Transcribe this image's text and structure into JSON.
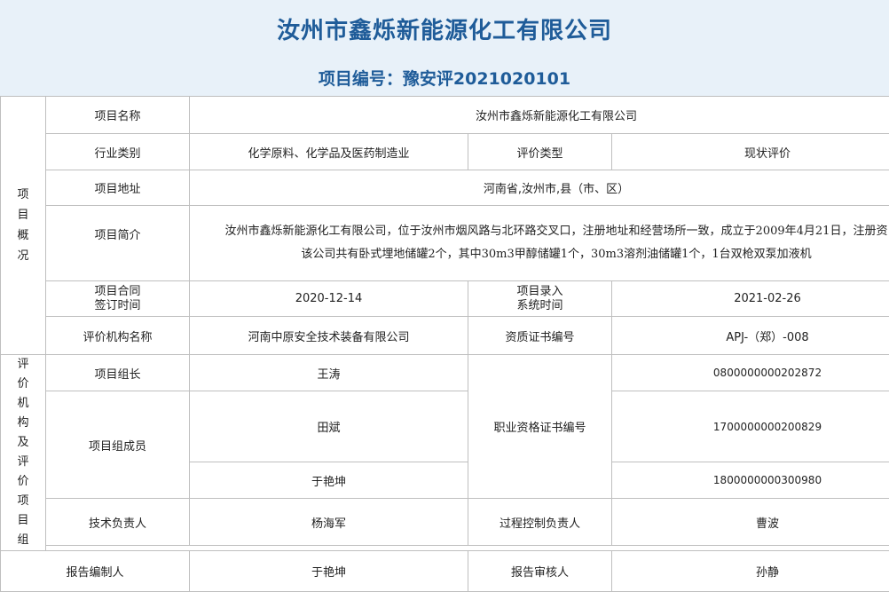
{
  "header": {
    "company_title": "汝州市鑫烁新能源化工有限公司",
    "project_no": "项目编号：豫安评2021020101"
  },
  "section_overview": {
    "chars": [
      "项",
      "目",
      "概",
      "况"
    ]
  },
  "section_org": {
    "chars": [
      "评",
      "价",
      "机",
      "构",
      "及",
      "评",
      "价",
      "项",
      "目",
      "组"
    ]
  },
  "rows": {
    "name_label": "项目名称",
    "name_value": "汝州市鑫烁新能源化工有限公司",
    "industry_label": "行业类别",
    "industry_value": "化学原料、化学品及医药制造业",
    "eval_type_label": "评价类型",
    "eval_type_value": "现状评价",
    "address_label": "项目地址",
    "address_value": "河南省,汝州市,县（市、区）",
    "intro_label": "项目简介",
    "intro_line1": "汝州市鑫烁新能源化工有限公司，位于汝州市烟风路与北环路交叉口，注册地址和经营场所一致，成立于2009年4月21日，注册资",
    "intro_line2": "该公司共有卧式埋地储罐2个，其中30m3甲醇储罐1个，30m3溶剂油储罐1个，1台双枪双泵加液机",
    "contract_label_1": "项目合同",
    "contract_label_2": "签订时间",
    "contract_value": "2020-12-14",
    "entry_label_1": "项目录入",
    "entry_label_2": "系统时间",
    "entry_value": "2021-02-26",
    "org_label": "评价机构名称",
    "org_value": "河南中原安全技术装备有限公司",
    "cert_label": "资质证书编号",
    "cert_value": "APJ-（郑）-008",
    "leader_label": "项目组长",
    "leader_value": "王涛",
    "leader_cert": "0800000000202872",
    "members_label": "项目组成员",
    "member1": "田斌",
    "member1_cert": "1700000000200829",
    "member2": "于艳坤",
    "member2_cert": "1800000000300980",
    "qual_label": "职业资格证书编号",
    "tech_label": "技术负责人",
    "tech_value": "杨海军",
    "process_label": "过程控制负责人",
    "process_value": "曹波",
    "author_label": "报告编制人",
    "author_value": "于艳坤",
    "reviewer_label": "报告审核人",
    "reviewer_value": "孙静"
  }
}
